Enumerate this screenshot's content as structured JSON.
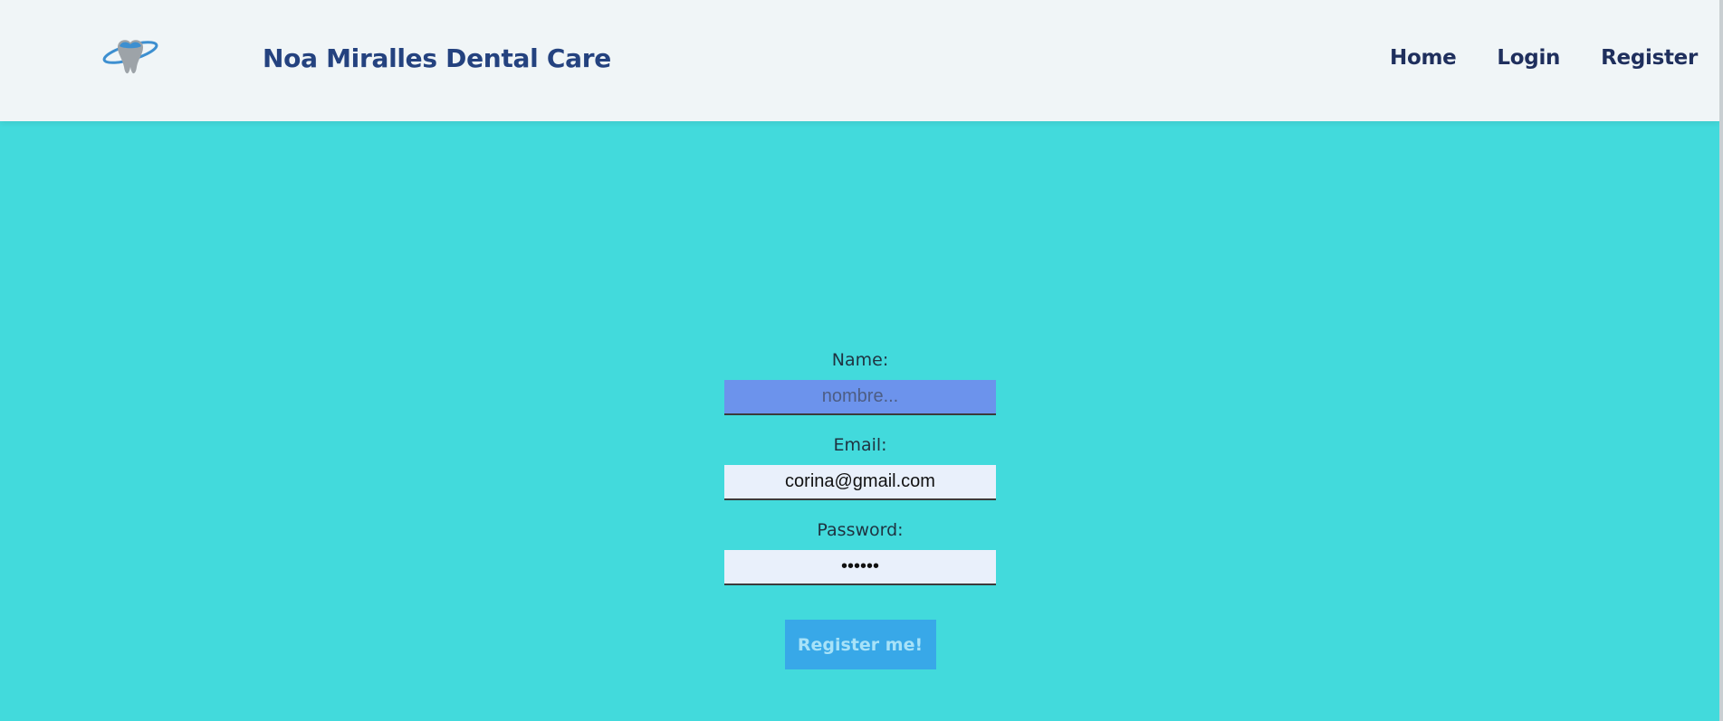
{
  "header": {
    "logo_icon": "tooth-logo-icon",
    "brand": "Noa Miralles Dental Care",
    "nav": {
      "home": "Home",
      "login": "Login",
      "register": "Register"
    }
  },
  "form": {
    "name_label": "Name:",
    "name_placeholder": "nombre...",
    "name_value": "",
    "email_label": "Email:",
    "email_value": "corina@gmail.com",
    "password_label": "Password:",
    "password_value": "••••••",
    "submit_label": "Register me!"
  },
  "colors": {
    "background": "#42dadc",
    "header": "#f0f5f7",
    "brand_text": "#24427f",
    "active_field": "#6c93ec",
    "button": "#38a8e8"
  }
}
